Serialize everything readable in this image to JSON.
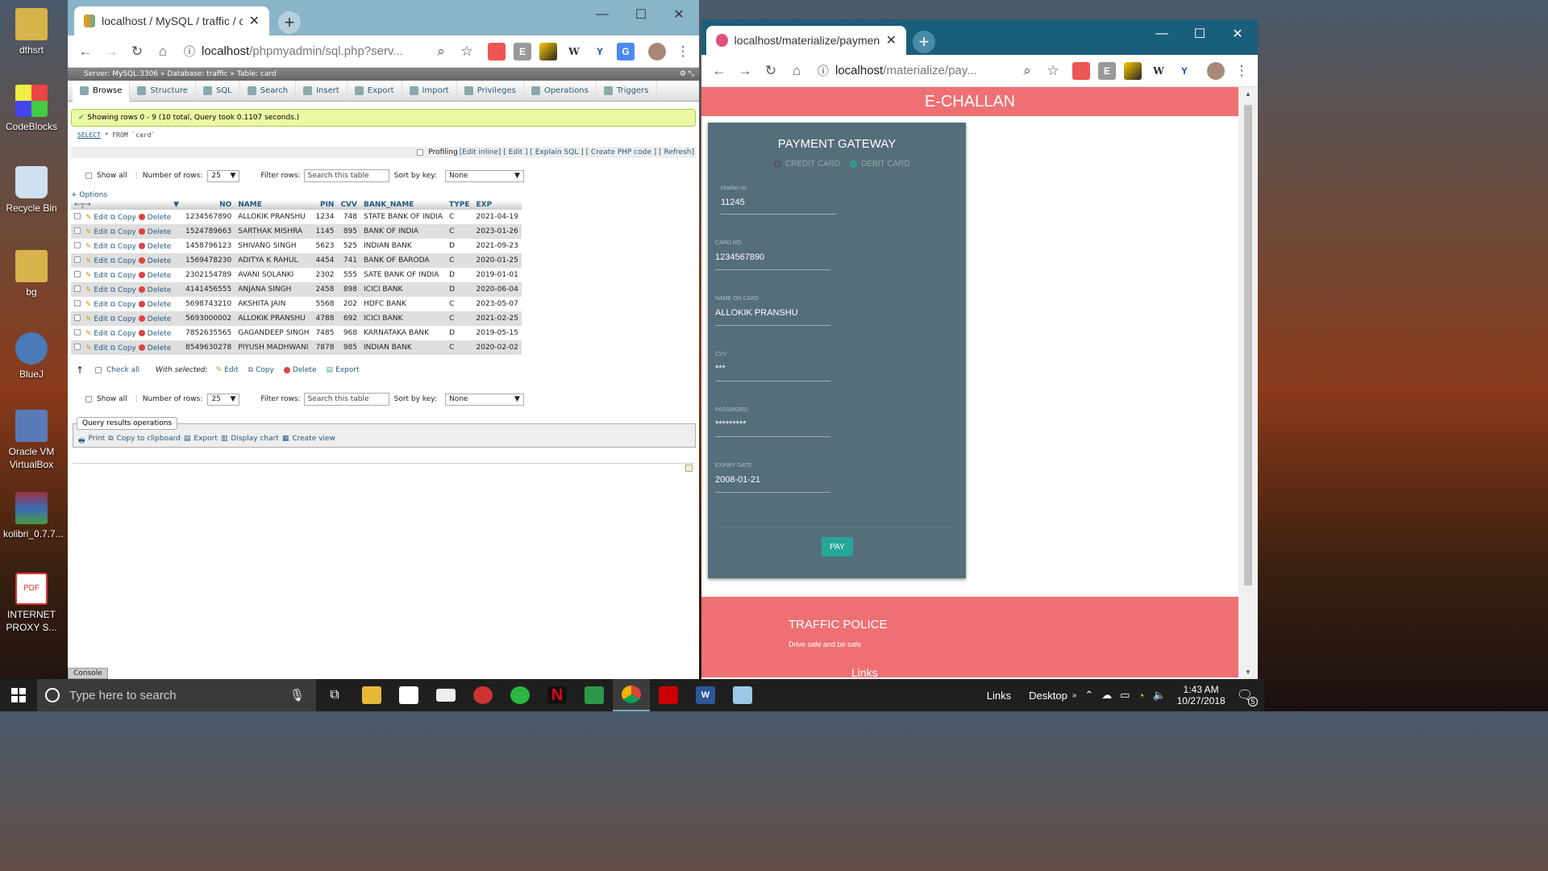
{
  "desktop": {
    "icons": [
      {
        "label": "dthsrt",
        "color": "#d8b24a"
      },
      {
        "label": "CodeBlocks",
        "color": "#3aa0d8"
      },
      {
        "label": "Recycle Bin",
        "color": "#a8c8e0"
      },
      {
        "label": "bg",
        "color": "#d8b24a"
      },
      {
        "label": "BlueJ",
        "color": "#4a7ab8"
      },
      {
        "label": "Oracle VM VirtualBox",
        "color": "#5a7ab8"
      },
      {
        "label": "kolibri_0.7.7...",
        "color": "#a03040"
      },
      {
        "label": "INTERNET PROXY S...",
        "color": "#e8e8e8"
      }
    ]
  },
  "left_window": {
    "tab_title": "localhost / MySQL / traffic / card",
    "url_host": "localhost",
    "url_path": "/phpmyadmin/sql.php?serv...",
    "breadcrumb": {
      "server": "Server: MySQL:3306 »",
      "database": "Database: traffic »",
      "table": "Table: card"
    },
    "tabs": [
      "Browse",
      "Structure",
      "SQL",
      "Search",
      "Insert",
      "Export",
      "Import",
      "Privileges",
      "Operations",
      "Triggers"
    ],
    "success_message": "Showing rows 0 - 9 (10 total, Query took 0.1107 seconds.)",
    "sql_keyword": "SELECT",
    "sql_rest": "* FROM `card`",
    "profiling": {
      "label": "Profiling",
      "links": "[Edit inline] [ Edit ] [ Explain SQL ] [ Create PHP code ] [ Refresh]"
    },
    "nav": {
      "show_all": "Show all",
      "number_of_rows_label": "Number of rows:",
      "number_of_rows_value": "25",
      "filter_label": "Filter rows:",
      "filter_placeholder": "Search this table",
      "sort_label": "Sort by key:",
      "sort_value": "None"
    },
    "options_link": "+ Options",
    "table": {
      "columns": [
        "NO",
        "NAME",
        "PIN",
        "CVV",
        "BANK_NAME",
        "TYPE",
        "EXP"
      ],
      "action_labels": {
        "edit": "Edit",
        "copy": "Copy",
        "delete": "Delete"
      },
      "rows": [
        [
          "1234567890",
          "ALLOKIK PRANSHU",
          "1234",
          "748",
          "STATE BANK OF INDIA",
          "C",
          "2021-04-19"
        ],
        [
          "1524789663",
          "SARTHAK MISHRA",
          "1145",
          "895",
          "BANK OF INDIA",
          "C",
          "2023-01-26"
        ],
        [
          "1458796123",
          "SHIVANG SINGH",
          "5623",
          "525",
          "INDIAN BANK",
          "D",
          "2021-09-23"
        ],
        [
          "1569478230",
          "ADITYA K RAHUL",
          "4454",
          "741",
          "BANK OF BARODA",
          "C",
          "2020-01-25"
        ],
        [
          "2302154789",
          "AVANI SOLANKI",
          "2302",
          "555",
          "SATE BANK OF INDIA",
          "D",
          "2019-01-01"
        ],
        [
          "4141456555",
          "ANJANA SINGH",
          "2458",
          "898",
          "ICICI BANK",
          "D",
          "2020-06-04"
        ],
        [
          "5698743210",
          "AKSHITA JAIN",
          "5568",
          "202",
          "HDFC BANK",
          "C",
          "2023-05-07"
        ],
        [
          "5693000002",
          "ALLOKIK PRANSHU",
          "4788",
          "692",
          "ICICI BANK",
          "C",
          "2021-02-25"
        ],
        [
          "7852635565",
          "GAGANDEEP SINGH",
          "7485",
          "968",
          "KARNATAKA BANK",
          "D",
          "2019-05-15"
        ],
        [
          "8549630278",
          "PIYUSH MADHWANI",
          "7878",
          "985",
          "INDIAN BANK",
          "C",
          "2020-02-02"
        ]
      ]
    },
    "bulk": {
      "check_all": "Check all",
      "with_selected": "With selected:",
      "edit": "Edit",
      "copy": "Copy",
      "delete": "Delete",
      "export": "Export"
    },
    "query_ops": {
      "legend": "Query results operations",
      "links": [
        "Print",
        "Copy to clipboard",
        "Export",
        "Display chart",
        "Create view"
      ]
    },
    "console": "Console"
  },
  "right_window": {
    "tab_title": "localhost/materialize/payment.p",
    "url_host": "localhost",
    "url_path": "/materialize/pay...",
    "header": "E-CHALLAN",
    "card": {
      "title": "PAYMENT GATEWAY",
      "radio_credit": "CREDIT CARD",
      "radio_debit": "DEBIT CARD",
      "fields": [
        {
          "label": "challan no",
          "value": "11245"
        },
        {
          "label": "CARD NO.",
          "value": "1234567890"
        },
        {
          "label": "NAME ON CARD",
          "value": "ALLOKIK PRANSHU"
        },
        {
          "label": "CVV",
          "value": "***"
        },
        {
          "label": "PASSWORD",
          "value": "*********"
        },
        {
          "label": "EXPIRY DATE",
          "value": "2008-01-21"
        }
      ],
      "pay_button": "PAY"
    },
    "footer": {
      "title": "TRAFFIC POLICE",
      "subtitle": "Drive safe and be safe",
      "links_heading": "Links"
    }
  },
  "taskbar": {
    "search_placeholder": "Type here to search",
    "links": "Links",
    "desktop": "Desktop",
    "time": "1:43 AM",
    "date": "10/27/2018",
    "notification_count": "5"
  }
}
